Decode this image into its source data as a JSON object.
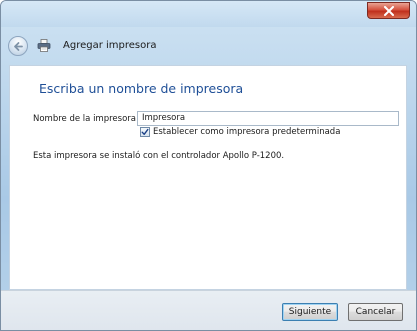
{
  "window": {
    "close_symbol": "x"
  },
  "header": {
    "title": "Agregar impresora",
    "back_icon": "back-arrow-icon",
    "app_icon": "printer-icon"
  },
  "content": {
    "main_instruction": "Escriba un nombre de impresora",
    "printer_name_label": "Nombre de la impresora:",
    "printer_name_value": "Impresora",
    "default_checkbox_label": "Establecer como impresora predeterminada",
    "default_checkbox_checked": true,
    "driver_text": "Esta impresora se instaló con el controlador Apollo P-1200."
  },
  "footer": {
    "next_label": "Siguiente",
    "cancel_label": "Cancelar"
  },
  "colors": {
    "instruction_blue": "#1f4f97",
    "close_red": "#c0301d",
    "frame_blue": "#a9c9e6"
  }
}
